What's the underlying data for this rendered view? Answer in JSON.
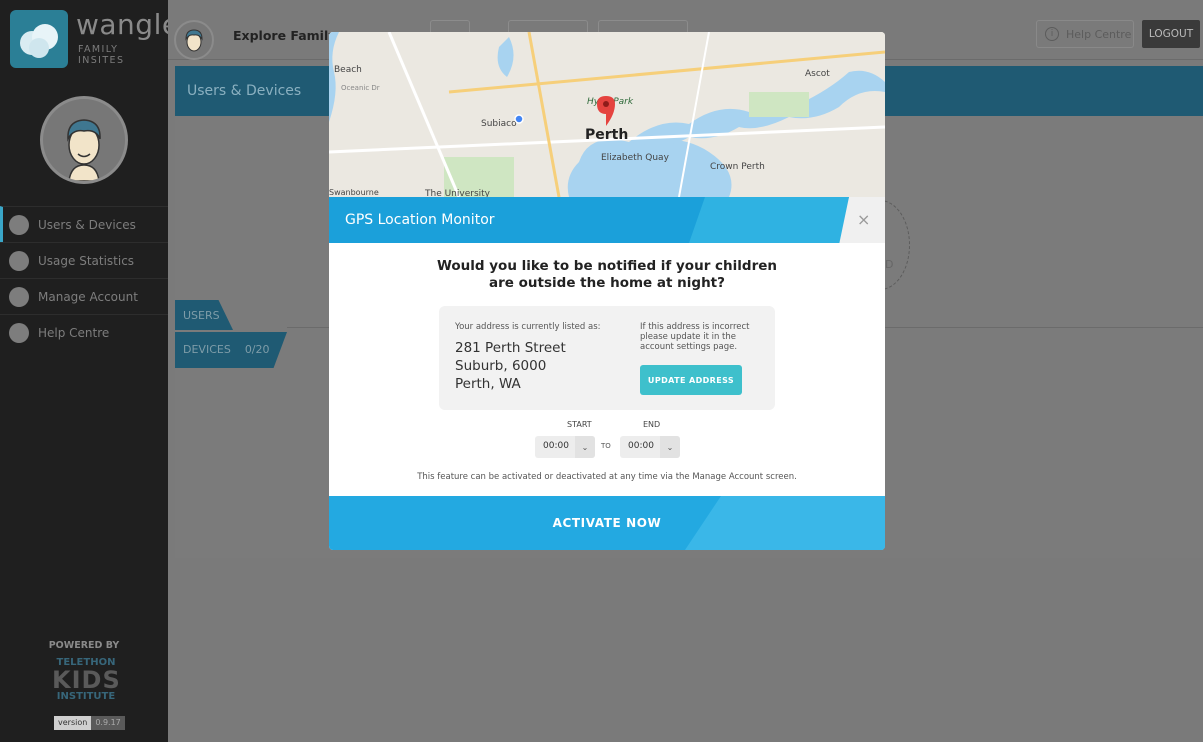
{
  "sidebar": {
    "logo_title": "wangle",
    "logo_subtitle": "FAMILY INSITES",
    "items": [
      {
        "label": "Users & Devices"
      },
      {
        "label": "Usage Statistics"
      },
      {
        "label": "Manage Account"
      },
      {
        "label": "Help Centre"
      }
    ],
    "powered_by": "POWERED BY",
    "partner_logo": {
      "line1": "TELETHON",
      "line2": "KIDS",
      "line3": "INSTITUTE"
    },
    "version_label": "version",
    "version_value": "0.9.17"
  },
  "header": {
    "explore_label": "Explore Family",
    "help_label": "Help Centre",
    "logout_label": "LOGOUT"
  },
  "content": {
    "section_title": "Users & Devices",
    "tab_users": "USERS",
    "tab_devices": "DEVICES",
    "devices_count": "0/20"
  },
  "modal": {
    "map_labels": [
      "Beach",
      "Oceanic Dr",
      "Subiaco",
      "Hyde Park",
      "Perth",
      "Elizabeth Quay",
      "Crown Perth",
      "Ascot",
      "Swanbourne",
      "The University"
    ],
    "title": "GPS Location Monitor",
    "close": "×",
    "question": "Would you like to be notified if your children are outside the home at night?",
    "address_label": "Your address is currently listed as:",
    "address_lines": [
      "281 Perth Street",
      "Suburb, 6000",
      "Perth, WA"
    ],
    "incorrect_note": "If this address is incorrect please update it in the account settings page.",
    "update_button": "UPDATE ADDRESS",
    "start_label": "START",
    "end_label": "END",
    "start_value": "00:00",
    "end_value": "00:00",
    "to_label": "TO",
    "feature_note": "This feature can be activated or deactivated at any time via the Manage Account screen.",
    "activate_button": "ACTIVATE NOW"
  },
  "colors": {
    "accent": "#1ba0da",
    "update_button": "#3ec0cc",
    "sidebar_bg": "#1f1f1f"
  }
}
